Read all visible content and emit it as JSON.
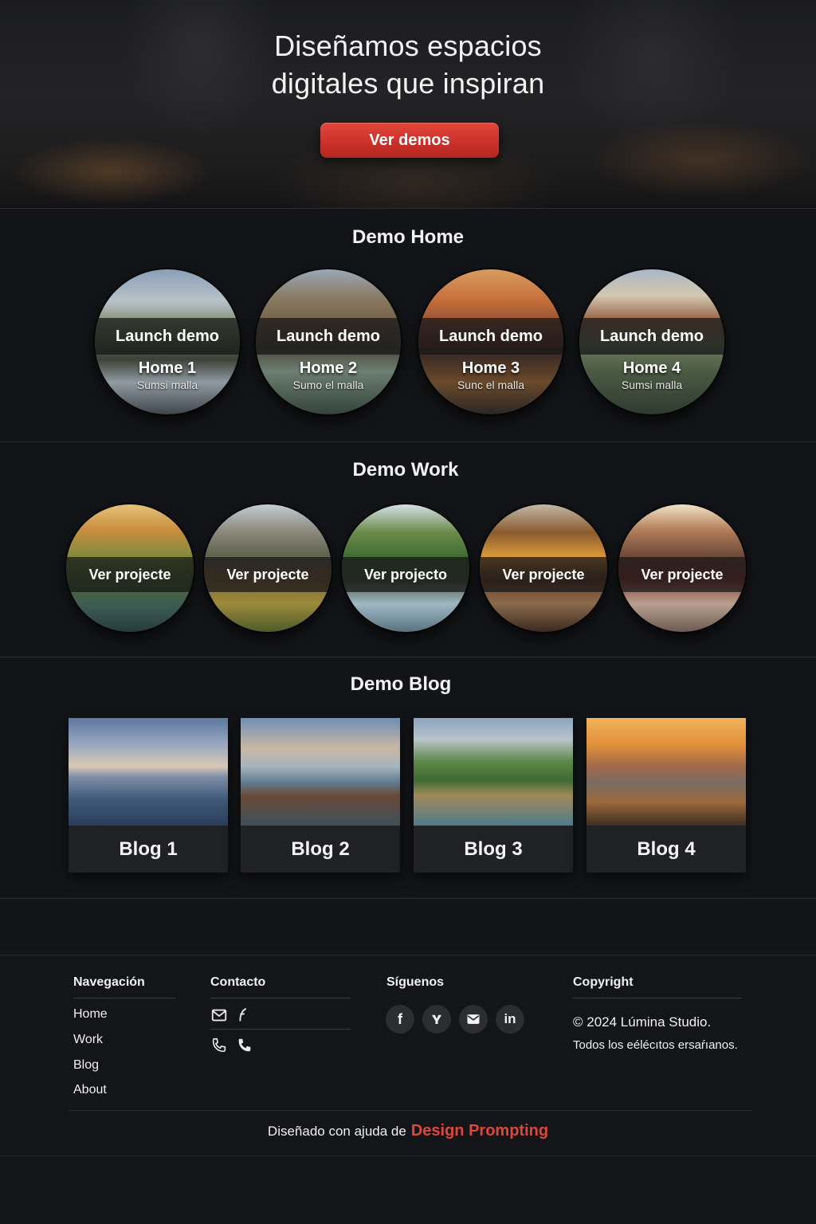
{
  "hero": {
    "title_line1": "Diseñamos espacios",
    "title_line2": "digitales que inspiran",
    "cta_label": "Ver demos",
    "cta_color": "#d13a30"
  },
  "demo_home": {
    "title": "Demo Home",
    "items": [
      {
        "action": "Launch demo",
        "name": "Home 1",
        "subtitle": "Sumsi malla"
      },
      {
        "action": "Launch demo",
        "name": "Home 2",
        "subtitle": "Sumo el malla"
      },
      {
        "action": "Launch demo",
        "name": "Home 3",
        "subtitle": "Sunc el malla"
      },
      {
        "action": "Launch demo",
        "name": "Home 4",
        "subtitle": "Sumsi malla"
      }
    ]
  },
  "demo_work": {
    "title": "Demo Work",
    "items": [
      {
        "action": "Ver projecte"
      },
      {
        "action": "Ver projecte"
      },
      {
        "action": "Ver projecto"
      },
      {
        "action": "Ver projecte"
      },
      {
        "action": "Ver projecte"
      }
    ]
  },
  "demo_blog": {
    "title": "Demo Blog",
    "items": [
      {
        "label": "Blog 1"
      },
      {
        "label": "Blog 2"
      },
      {
        "label": "Blog 3"
      },
      {
        "label": "Blog 4"
      }
    ]
  },
  "footer": {
    "nav": {
      "heading": "Navegación",
      "links": [
        "Home",
        "Work",
        "Blog",
        "About"
      ]
    },
    "contact": {
      "heading": "Contacto",
      "icons": [
        "mail-icon",
        "feather-icon",
        "phone-icon",
        "phone-icon"
      ]
    },
    "social": {
      "heading": "Síguenos",
      "icons": [
        "facebook-icon",
        "twitter-icon",
        "mail-icon",
        "linkedin-icon"
      ]
    },
    "copyright": {
      "heading": "Copyright",
      "line1": "© 2024 Lúmina Studio.",
      "line2": "Todos los eélécıtos ersaŕıanos."
    },
    "credit": {
      "prefix": "Diseñado con ajuda de",
      "brand": "Design Prompting",
      "brand_color": "#e0473b"
    }
  }
}
